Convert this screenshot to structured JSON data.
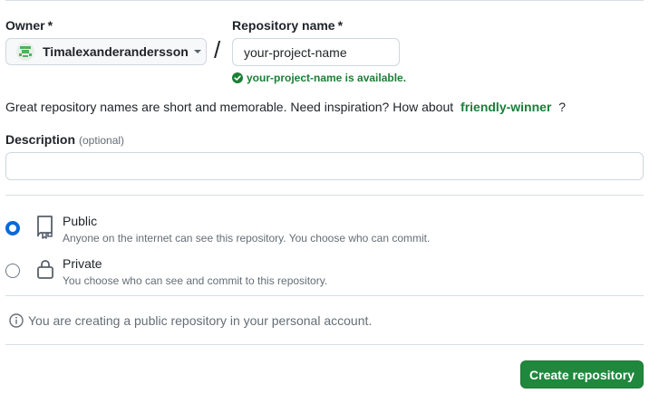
{
  "owner": {
    "label": "Owner",
    "required_mark": "*",
    "selected": "Timalexanderandersson",
    "avatar_color": "#4cb35a"
  },
  "separator": "/",
  "repository": {
    "label": "Repository name",
    "required_mark": "*",
    "value": "your-project-name",
    "availability": "your-project-name is available."
  },
  "hint": {
    "text": "Great repository names are short and memorable. Need inspiration? How about",
    "suggestion": "friendly-winner",
    "end": "?"
  },
  "description": {
    "label": "Description",
    "optional": "(optional)",
    "value": ""
  },
  "visibility": {
    "options": [
      {
        "title": "Public",
        "desc": "Anyone on the internet can see this repository. You choose who can commit.",
        "checked": true,
        "icon": "repo-icon"
      },
      {
        "title": "Private",
        "desc": "You choose who can see and commit to this repository.",
        "checked": false,
        "icon": "lock-icon"
      }
    ]
  },
  "notice": "You are creating a public repository in your personal account.",
  "submit": "Create repository",
  "colors": {
    "accent_green": "#1a7f37",
    "button_green": "#1f883d",
    "radio_blue": "#0969da"
  }
}
